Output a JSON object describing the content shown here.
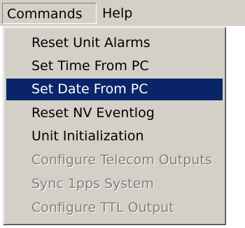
{
  "menubar": {
    "commands_label": "Commands",
    "help_label": "Help"
  },
  "commands_menu": {
    "items": [
      {
        "label": "Reset Unit Alarms",
        "enabled": true,
        "selected": false
      },
      {
        "label": "Set Time From PC",
        "enabled": true,
        "selected": false
      },
      {
        "label": "Set Date From PC",
        "enabled": true,
        "selected": true
      },
      {
        "label": "Reset NV Eventlog",
        "enabled": true,
        "selected": false
      },
      {
        "label": "Unit Initialization",
        "enabled": true,
        "selected": false
      },
      {
        "label": "Configure Telecom Outputs",
        "enabled": false,
        "selected": false
      },
      {
        "label": "Sync 1pps System",
        "enabled": false,
        "selected": false
      },
      {
        "label": "Configure TTL Output",
        "enabled": false,
        "selected": false
      }
    ]
  },
  "colors": {
    "menu_face": "#d4d0c8",
    "highlight": "#0a246a",
    "highlight_text": "#ffffff",
    "disabled_text": "#808080"
  }
}
